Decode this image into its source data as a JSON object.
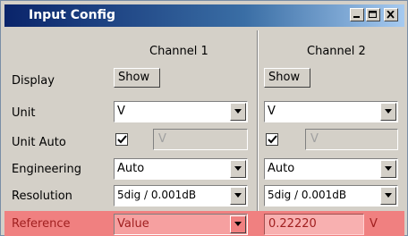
{
  "window": {
    "title": "Input Config",
    "controls": [
      "minimize-icon",
      "maximize-icon",
      "close-icon"
    ]
  },
  "columns": [
    "Channel 1",
    "Channel 2"
  ],
  "rows": {
    "display": {
      "label": "Display",
      "ch1": "Show",
      "ch2": "Show"
    },
    "unit": {
      "label": "Unit",
      "ch1": "V",
      "ch2": "V"
    },
    "unit_auto": {
      "label": "Unit Auto",
      "ch1_checked": true,
      "ch1_field": "V",
      "ch2_checked": true,
      "ch2_field": "V"
    },
    "engineering": {
      "label": "Engineering",
      "ch1": "Auto",
      "ch2": "Auto"
    },
    "resolution": {
      "label": "Resolution",
      "ch1": "5dig / 0.001dB",
      "ch2": "5dig / 0.001dB"
    },
    "reference": {
      "label": "Reference",
      "ch1": "Value",
      "ch2_value": "0.22220",
      "ch2_unit": "V"
    }
  },
  "colors": {
    "titlebar_start": "#0a246a",
    "titlebar_end": "#a6caf0",
    "dialog_bg": "#d4d0c8",
    "highlight_row": "#f08080"
  }
}
